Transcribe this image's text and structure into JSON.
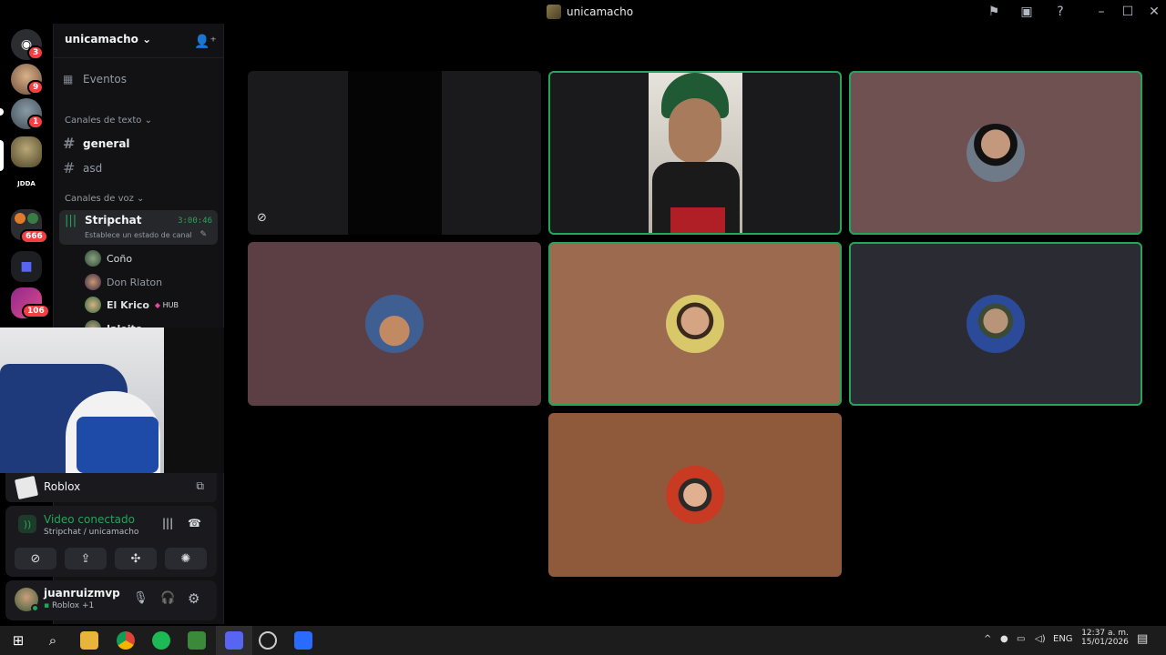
{
  "window": {
    "title": "unicamacho"
  },
  "rail": {
    "servers": [
      {
        "name": "Discord home",
        "badge": "3"
      },
      {
        "name": "server-2",
        "badge": "9"
      },
      {
        "name": "server-3",
        "badge": "1"
      },
      {
        "name": "unicamacho",
        "badge": ""
      },
      {
        "name": "JDDA",
        "label": "JDDA",
        "badge": ""
      },
      {
        "name": "folder-1",
        "badge": "666"
      },
      {
        "name": "folder-2",
        "badge": ""
      },
      {
        "name": "server-8",
        "badge": "106"
      }
    ]
  },
  "channels": {
    "server_name": "unicamacho",
    "events_label": "Eventos",
    "text_category": "Canales de texto",
    "text_channels": [
      "general",
      "asd"
    ],
    "voice_category": "Canales de voz",
    "voice_channel": {
      "name": "Stripchat",
      "timer": "3:00:46",
      "status_placeholder": "Establece un estado de canal"
    },
    "members": [
      {
        "name": "Coño",
        "color": "#dbdee1"
      },
      {
        "name": "Don Rlaton",
        "color": "#949ba4"
      },
      {
        "name": "El Krico",
        "tag": "HUB",
        "color": "#dbdee1"
      },
      {
        "name": "Jaleito",
        "color": "#dbdee1"
      }
    ]
  },
  "activity": {
    "game": "Roblox"
  },
  "voice_status": {
    "status": "Video conectado",
    "location": "Stripchat / unicamacho"
  },
  "user": {
    "name": "juanruizmvp",
    "activity": "Roblox +1"
  },
  "taskbar": {
    "language": "ENG",
    "time": "12:37 a. m.",
    "date": "15/01/2026"
  },
  "colors": {
    "speaking": "#23a55a",
    "tile_mauve": "#6f5152",
    "tile_rose": "#5b3f44",
    "tile_tan": "#9b6a4f",
    "tile_slate": "#2b2c33",
    "tile_brown": "#8f5a3c",
    "badge": "#f23f43"
  }
}
